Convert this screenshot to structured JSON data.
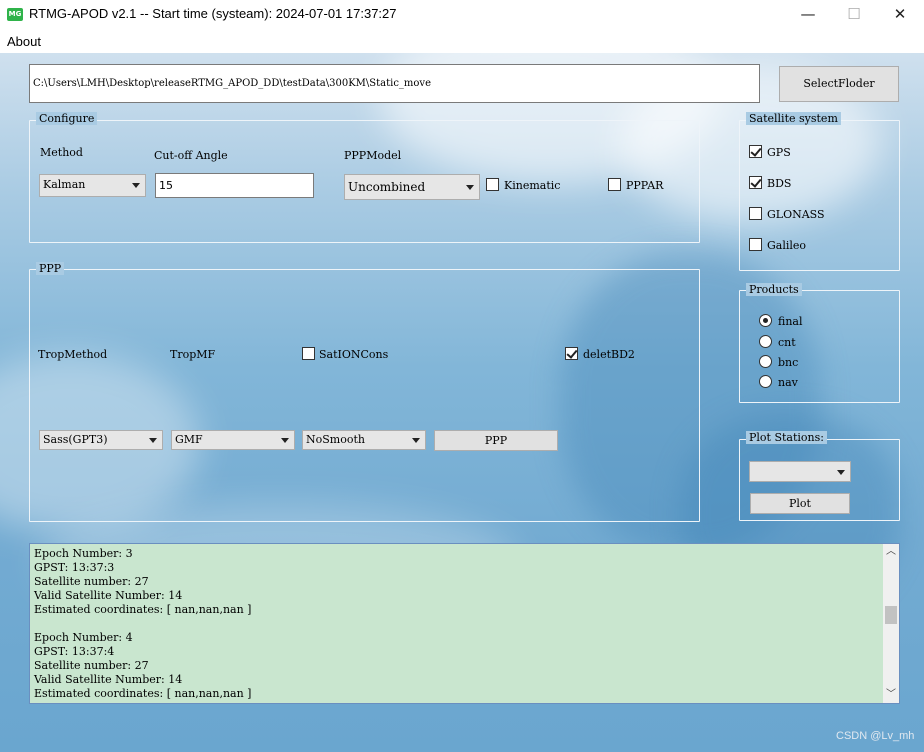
{
  "window": {
    "app_icon_text": "MG",
    "title": "RTMG-APOD v2.1 -- Start time (systeam): 2024-07-01 17:37:27",
    "minimize_glyph": "—",
    "maximize_glyph": "☐",
    "close_glyph": "✕"
  },
  "menu": {
    "about": "About"
  },
  "path": {
    "value": "C:\\Users\\LMH\\Desktop\\releaseRTMG_APOD_DD\\testData\\300KM\\Static_move",
    "select_button": "SelectFloder"
  },
  "configure": {
    "title": "Configure",
    "method_label": "Method",
    "method_value": "Kalman",
    "cutoff_label": "Cut-off Angle",
    "cutoff_value": "15",
    "pppmodel_label": "PPPModel",
    "pppmodel_value": "Uncombined",
    "kinematic_label": "Kinematic",
    "kinematic_checked": false,
    "pppar_label": "PPPAR",
    "pppar_checked": false
  },
  "ppp": {
    "title": "PPP",
    "tropmethod_label": "TropMethod",
    "tropmf_label": "TropMF",
    "sationcons_label": "SatIONCons",
    "sationcons_checked": false,
    "deletbd2_label": "deletBD2",
    "deletbd2_checked": true,
    "trop_value": "Sass(GPT3)",
    "mf_value": "GMF",
    "smooth_value": "NoSmooth",
    "ppp_button": "PPP"
  },
  "satellite_system": {
    "title": "Satellite system",
    "items": [
      {
        "label": "GPS",
        "checked": true
      },
      {
        "label": "BDS",
        "checked": true
      },
      {
        "label": "GLONASS",
        "checked": false
      },
      {
        "label": "Galileo",
        "checked": false
      }
    ]
  },
  "products": {
    "title": "Products",
    "items": [
      {
        "label": "final",
        "selected": true
      },
      {
        "label": "cnt",
        "selected": false
      },
      {
        "label": "bnc",
        "selected": false
      },
      {
        "label": "nav",
        "selected": false
      }
    ]
  },
  "plot_stations": {
    "title": "Plot Stations:",
    "selected": "",
    "plot_button": "Plot"
  },
  "log": {
    "lines": [
      "Epoch Number: 3",
      "GPST: 13:37:3",
      "Satellite number: 27",
      "Valid Satellite Number: 14",
      "Estimated coordinates: [ nan,nan,nan ]",
      "",
      "Epoch Number: 4",
      "GPST: 13:37:4",
      "Satellite number: 27",
      "Valid Satellite Number: 14",
      "Estimated coordinates: [ nan,nan,nan ]"
    ],
    "scroll_up_glyph": "︿",
    "scroll_down_glyph": "﹀"
  },
  "watermark": "CSDN @Lv_mh",
  "colors": {
    "log_bg": "#c9e6cf",
    "app_icon": "#2fb34a"
  }
}
